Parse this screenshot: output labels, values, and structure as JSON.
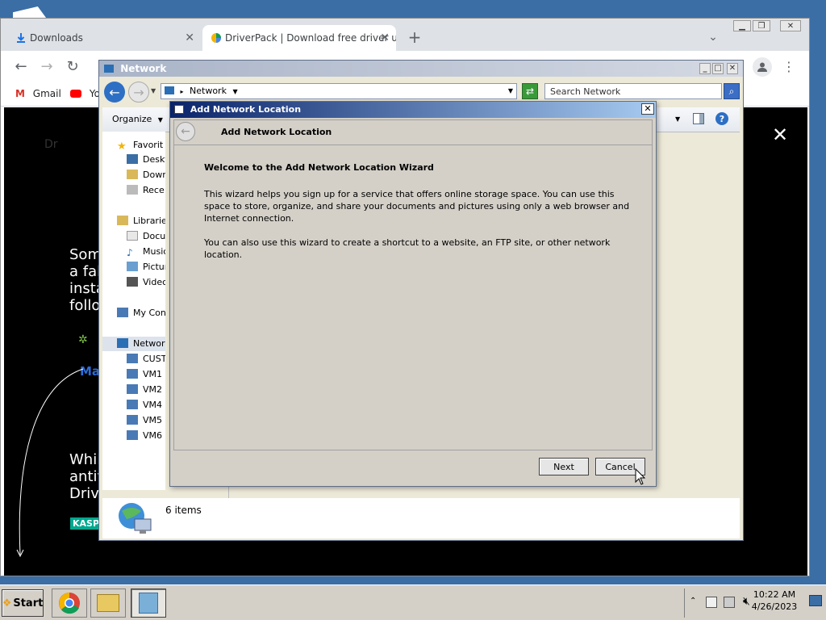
{
  "chrome": {
    "tabs": [
      {
        "label": "Downloads"
      },
      {
        "label": "DriverPack | Download free driver u"
      }
    ],
    "new_tab_label": "+",
    "bookmarks": [
      {
        "label": "Gmail"
      },
      {
        "label": "Yo"
      }
    ],
    "page": {
      "para1": [
        "Som",
        "a fals",
        "insta",
        "follo"
      ],
      "para2": [
        "Whil",
        "antiv",
        "Drive"
      ],
      "brand1": "Ma",
      "brand2": "KASPD",
      "faded": "Dr"
    }
  },
  "explorer": {
    "title": "Network",
    "breadcrumb": "Network",
    "search_placeholder": "Search Network",
    "organize_label": "Organize",
    "nav": {
      "favorites": "Favorit",
      "fav_items": [
        "Deskt",
        "Dowr",
        "Rece"
      ],
      "libraries": "Librarie",
      "lib_items": [
        "Docu",
        "Music",
        "Pictur",
        "Videc"
      ],
      "computer": "My Con",
      "network": "Networ",
      "net_items": [
        "CUST",
        "VM1",
        "VM2",
        "VM4",
        "VM5",
        "VM6"
      ]
    },
    "status": "6 items"
  },
  "wizard": {
    "title": "Add Network Location",
    "header": "Add Network Location",
    "welcome": "Welcome to the Add Network Location Wizard",
    "p1": "This wizard helps you sign up for a service that offers online storage space.  You can use this space to store, organize, and share your documents and pictures using only a web browser and Internet connection.",
    "p2": "You can also use this wizard to create a shortcut to a website, an FTP site, or other network location.",
    "next_label": "Next",
    "cancel_label": "Cancel"
  },
  "taskbar": {
    "start_label": "Start",
    "time": "10:22 AM",
    "date": "4/26/2023"
  },
  "colors": {
    "desktop": "#3a6ea5",
    "wizard_title": "#0a246a",
    "dialog_bg": "#d4d0c8"
  }
}
